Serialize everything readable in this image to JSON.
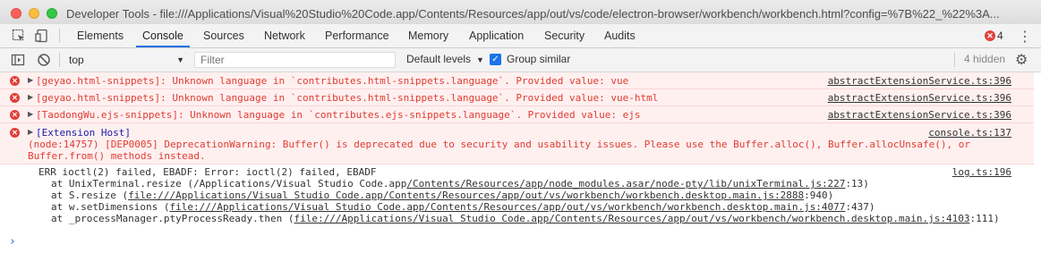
{
  "window": {
    "title": "Developer Tools - file:///Applications/Visual%20Studio%20Code.app/Contents/Resources/app/out/vs/code/electron-browser/workbench/workbench.html?config=%7B%22_%22%3A..."
  },
  "tabs": [
    {
      "label": "Elements",
      "active": false
    },
    {
      "label": "Console",
      "active": true
    },
    {
      "label": "Sources",
      "active": false
    },
    {
      "label": "Network",
      "active": false
    },
    {
      "label": "Performance",
      "active": false
    },
    {
      "label": "Memory",
      "active": false
    },
    {
      "label": "Application",
      "active": false
    },
    {
      "label": "Security",
      "active": false
    },
    {
      "label": "Audits",
      "active": false
    }
  ],
  "status": {
    "error_count": "4"
  },
  "toolbar": {
    "context": "top",
    "filter_placeholder": "Filter",
    "levels_label": "Default levels",
    "group_similar_label": "Group similar",
    "group_similar_checked": true,
    "hidden_label": "4 hidden"
  },
  "messages": [
    {
      "text": "[geyao.html-snippets]: Unknown language in `contributes.html-snippets.language`. Provided value: vue",
      "source": "abstractExtensionService.ts:396"
    },
    {
      "text": "[geyao.html-snippets]: Unknown language in `contributes.html-snippets.language`. Provided value: vue-html",
      "source": "abstractExtensionService.ts:396"
    },
    {
      "text": "[TaodongWu.ejs-snippets]: Unknown language in `contributes.ejs-snippets.language`. Provided value: ejs",
      "source": "abstractExtensionService.ts:396"
    },
    {
      "header": "[Extension Host]",
      "line1": "(node:14757) [DEP0005] DeprecationWarning: Buffer() is deprecated due to security and usability issues. Please use the Buffer.alloc(), Buffer.allocUnsafe(), or",
      "line2": "Buffer.from() methods instead.",
      "source": "console.ts:137"
    }
  ],
  "log": {
    "line0": "ERR ioctl(2) failed, EBADF: Error: ioctl(2) failed, EBADF",
    "source": "log.ts:196",
    "stack": [
      {
        "prefix": "at UnixTerminal.resize (/Applications/Visual Studio Code.app",
        "link": "/Contents/Resources/app/node_modules.asar/node-pty/lib/unixTerminal.js:227",
        "suffix": ":13)"
      },
      {
        "prefix": "at S.resize (",
        "link": "file:///Applications/Visual Studio Code.app/Contents/Resources/app/out/vs/workbench/workbench.desktop.main.js:2888",
        "suffix": ":940)"
      },
      {
        "prefix": "at w.setDimensions (",
        "link": "file:///Applications/Visual Studio Code.app/Contents/Resources/app/out/vs/workbench/workbench.desktop.main.js:4077",
        "suffix": ":437)"
      },
      {
        "prefix": "at _processManager.ptyProcessReady.then (",
        "link": "file:///Applications/Visual Studio Code.app/Contents/Resources/app/out/vs/workbench/workbench.desktop.main.js:4103",
        "suffix": ":111)"
      }
    ]
  },
  "prompt": "›",
  "colors": {
    "error_red": "#e03c31",
    "error_bg": "#fff0f0",
    "accent": "#1a73e8"
  },
  "icons": [
    "inspect-icon",
    "device-icon",
    "sidebar-toggle-icon",
    "clear-console-icon",
    "error-icon",
    "expand-arrow-icon",
    "settings-gear-icon",
    "kebab-menu-icon"
  ]
}
